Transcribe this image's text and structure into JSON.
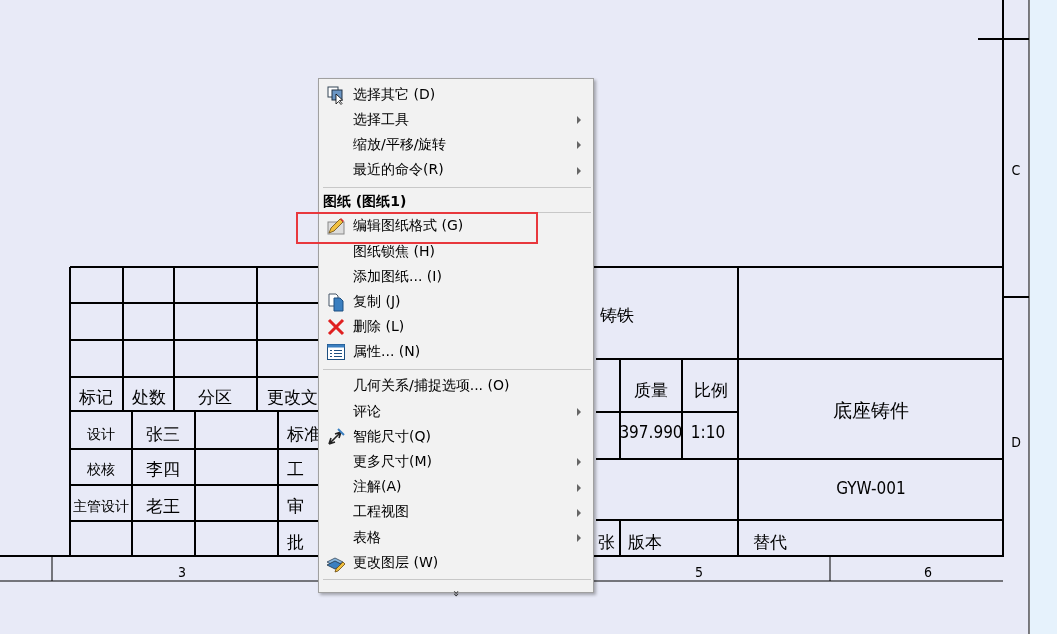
{
  "drawing": {
    "zone_labels": [
      "C",
      "D"
    ],
    "column_numbers": [
      "3",
      "5",
      "6"
    ],
    "title_block": {
      "revision_headers": [
        "标记",
        "处数",
        "分区",
        "更改文"
      ],
      "signoffs": [
        {
          "role": "设计",
          "name": "张三"
        },
        {
          "role": "校核",
          "name": "李四"
        },
        {
          "role": "主管设计",
          "name": "老王"
        }
      ],
      "approval_labels": [
        "标准",
        "工",
        "审",
        "批"
      ],
      "material": "铸铁",
      "weight_label": "质量",
      "scale_label": "比例",
      "weight": "397.990",
      "scale": "1:10",
      "part_name": "底座铸件",
      "drawing_number": "GYW-001",
      "sheet_label": "张",
      "version_label": "版本",
      "replaces_label": "替代"
    }
  },
  "context_menu": {
    "items": [
      {
        "kind": "item",
        "label": "选择其它 (D)",
        "submenu": false,
        "annotated": false
      },
      {
        "kind": "item",
        "label": "选择工具",
        "submenu": true,
        "annotated": false
      },
      {
        "kind": "item",
        "label": "缩放/平移/旋转",
        "submenu": true,
        "annotated": false
      },
      {
        "kind": "item",
        "label": "最近的命令(R)",
        "submenu": true,
        "annotated": false
      },
      {
        "kind": "separator"
      },
      {
        "kind": "header",
        "label": "图纸 (图纸1)"
      },
      {
        "kind": "item",
        "label": "编辑图纸格式 (G)",
        "submenu": false,
        "annotated": true
      },
      {
        "kind": "item",
        "label": "图纸锁焦 (H)",
        "submenu": false,
        "annotated": false
      },
      {
        "kind": "item",
        "label": "添加图纸... (I)",
        "submenu": false,
        "annotated": false
      },
      {
        "kind": "item",
        "label": "复制 (J)",
        "submenu": false,
        "annotated": false
      },
      {
        "kind": "item",
        "label": "删除 (L)",
        "submenu": false,
        "annotated": false
      },
      {
        "kind": "item",
        "label": "属性... (N)",
        "submenu": false,
        "annotated": false
      },
      {
        "kind": "separator"
      },
      {
        "kind": "item",
        "label": "几何关系/捕捉选项... (O)",
        "submenu": false,
        "annotated": false
      },
      {
        "kind": "item",
        "label": "评论",
        "submenu": true,
        "annotated": false
      },
      {
        "kind": "item",
        "label": "智能尺寸(Q)",
        "submenu": false,
        "annotated": false
      },
      {
        "kind": "item",
        "label": "更多尺寸(M)",
        "submenu": true,
        "annotated": false
      },
      {
        "kind": "item",
        "label": "注解(A)",
        "submenu": true,
        "annotated": false
      },
      {
        "kind": "item",
        "label": "工程视图",
        "submenu": true,
        "annotated": false
      },
      {
        "kind": "item",
        "label": "表格",
        "submenu": true,
        "annotated": false
      },
      {
        "kind": "item",
        "label": "更改图层 (W)",
        "submenu": false,
        "annotated": false
      },
      {
        "kind": "separator"
      },
      {
        "kind": "expand",
        "label": "»"
      }
    ]
  }
}
